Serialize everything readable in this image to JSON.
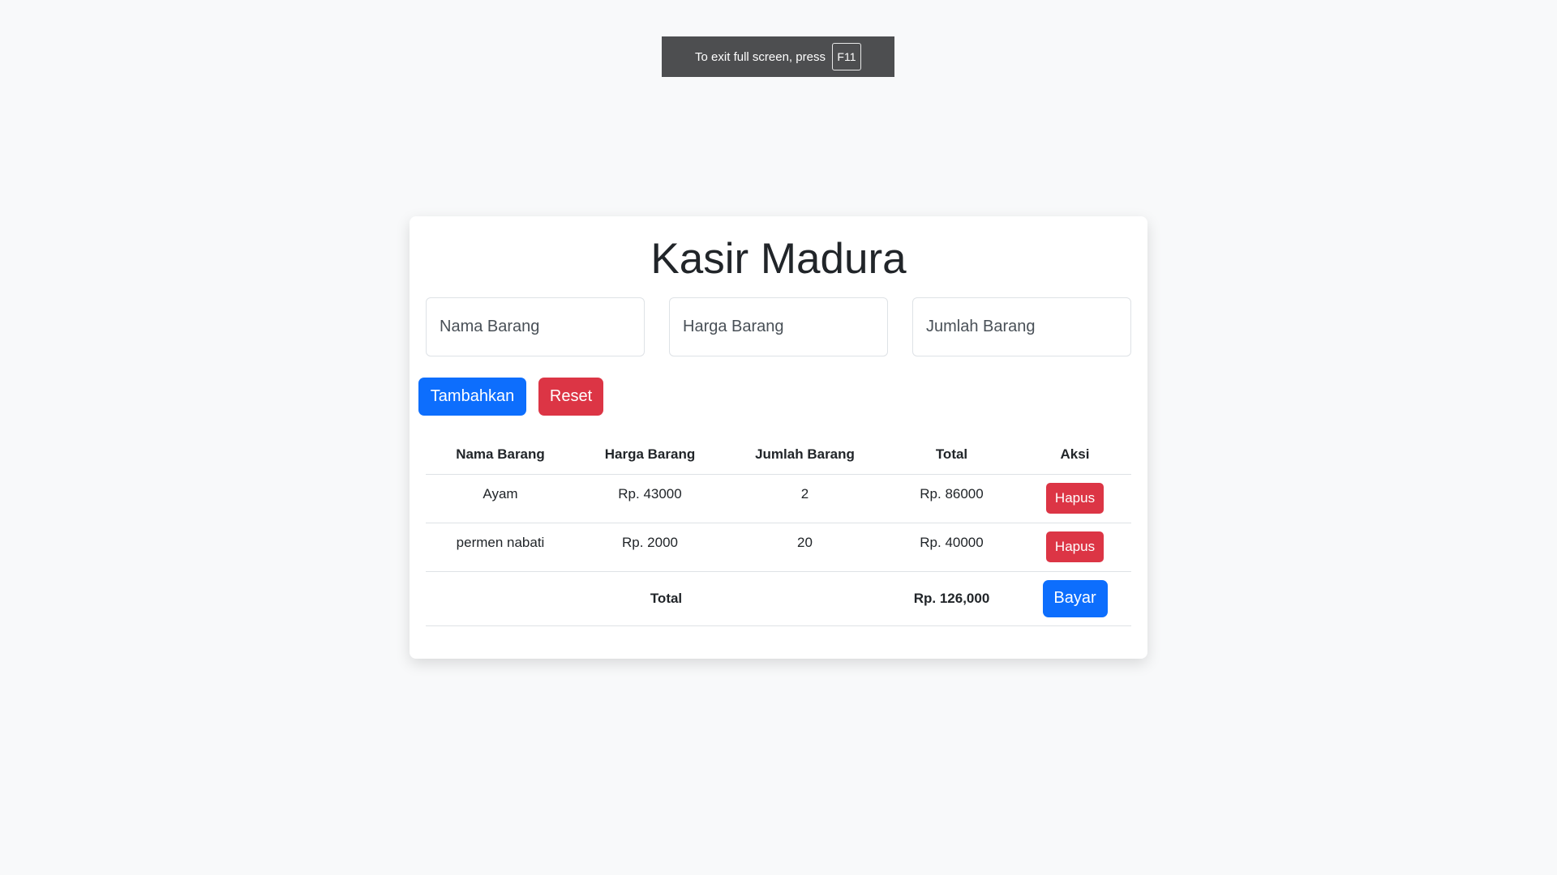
{
  "fullscreen_notice": {
    "text": "To exit full screen, press",
    "key": "F11"
  },
  "app": {
    "title": "Kasir Madura"
  },
  "form": {
    "name_placeholder": "Nama Barang",
    "price_placeholder": "Harga Barang",
    "qty_placeholder": "Jumlah Barang",
    "add_label": "Tambahkan",
    "reset_label": "Reset"
  },
  "table": {
    "headers": [
      "Nama Barang",
      "Harga Barang",
      "Jumlah Barang",
      "Total",
      "Aksi"
    ],
    "rows": [
      {
        "name": "Ayam",
        "price": "Rp. 43000",
        "qty": "2",
        "total": "Rp. 86000",
        "action": "Hapus"
      },
      {
        "name": "permen nabati",
        "price": "Rp. 2000",
        "qty": "20",
        "total": "Rp. 40000",
        "action": "Hapus"
      }
    ],
    "footer": {
      "label": "Total",
      "amount": "Rp. 126,000",
      "pay_label": "Bayar"
    }
  },
  "colors": {
    "primary": "#0d6efd",
    "danger": "#dc3545",
    "background": "#f8f9fa"
  }
}
